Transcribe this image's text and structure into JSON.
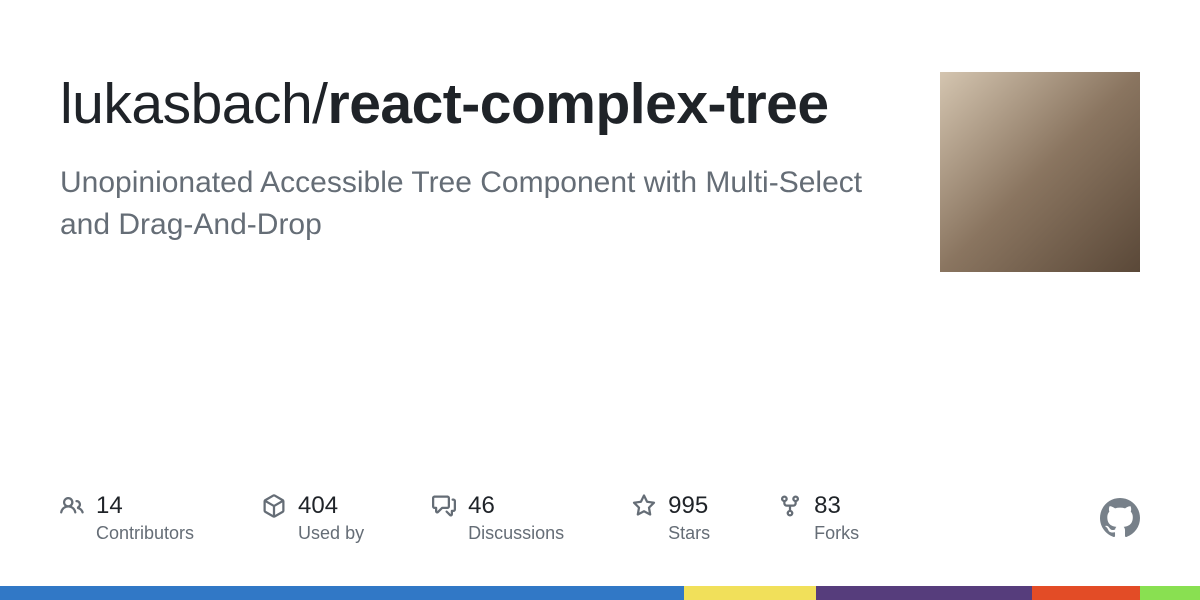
{
  "repo": {
    "owner": "lukasbach",
    "name": "react-complex-tree",
    "description": "Unopinionated Accessible Tree Component with Multi-Select and Drag-And-Drop"
  },
  "stats": {
    "contributors": {
      "value": "14",
      "label": "Contributors"
    },
    "usedby": {
      "value": "404",
      "label": "Used by"
    },
    "discussions": {
      "value": "46",
      "label": "Discussions"
    },
    "stars": {
      "value": "995",
      "label": "Stars"
    },
    "forks": {
      "value": "83",
      "label": "Forks"
    }
  },
  "languages": [
    {
      "color": "#3178c6",
      "percent": 57
    },
    {
      "color": "#f1e05a",
      "percent": 11
    },
    {
      "color": "#563d7c",
      "percent": 18
    },
    {
      "color": "#e34c26",
      "percent": 9
    },
    {
      "color": "#89e051",
      "percent": 5
    }
  ]
}
